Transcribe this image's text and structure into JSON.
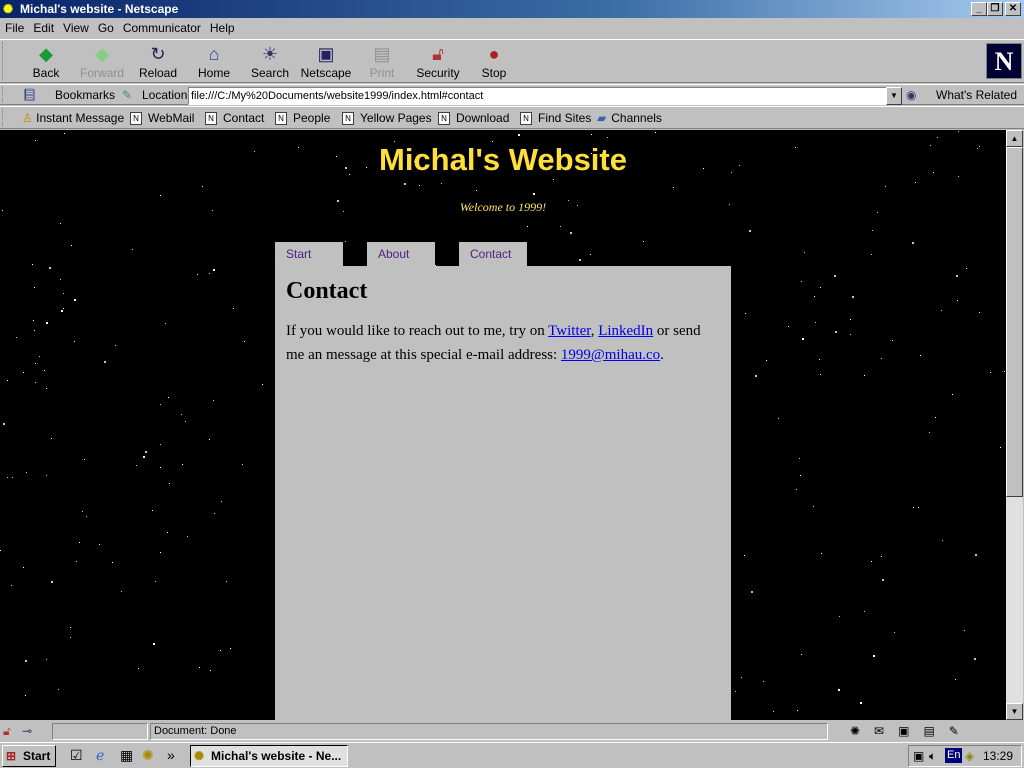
{
  "window": {
    "title": "Michal's website - Netscape",
    "controls": [
      "_",
      "❐",
      "✕"
    ]
  },
  "menu": [
    "File",
    "Edit",
    "View",
    "Go",
    "Communicator",
    "Help"
  ],
  "nav_toolbar": [
    {
      "label": "Back",
      "icon": "back-arrow-icon",
      "enabled": true
    },
    {
      "label": "Forward",
      "icon": "forward-arrow-icon",
      "enabled": false
    },
    {
      "label": "Reload",
      "icon": "reload-icon",
      "enabled": true
    },
    {
      "label": "Home",
      "icon": "home-icon",
      "enabled": true
    },
    {
      "label": "Search",
      "icon": "search-icon",
      "enabled": true
    },
    {
      "label": "Netscape",
      "icon": "my-netscape-icon",
      "enabled": true
    },
    {
      "label": "Print",
      "icon": "print-icon",
      "enabled": false
    },
    {
      "label": "Security",
      "icon": "padlock-icon",
      "enabled": true
    },
    {
      "label": "Stop",
      "icon": "stop-icon",
      "enabled": true
    }
  ],
  "location": {
    "bookmarks_label": "Bookmarks",
    "label": "Location:",
    "url": "file:///C:/My%20Documents/website1999/index.html#contact",
    "whats_related": "What's Related"
  },
  "personal_toolbar": [
    "Instant Message",
    "WebMail",
    "Contact",
    "People",
    "Yellow Pages",
    "Download",
    "Find Sites",
    "Channels"
  ],
  "page": {
    "title": "Michal's Website",
    "subtitle": "Welcome to 1999!",
    "tabs": [
      "Start",
      "About",
      "Contact"
    ],
    "heading": "Contact",
    "text1": "If you would like to reach out to me, try on ",
    "link_twitter": "Twitter",
    "comma": ", ",
    "link_linkedin": "LinkedIn",
    "text2": " or send me an message at this special e-mail address: ",
    "link_email": "1999@mihau.co",
    "period": ".",
    "colors": {
      "title": "#ffe03a",
      "background": "#000000",
      "panel": "#c0c0c0",
      "tab_text": "#502080"
    }
  },
  "status": {
    "text": "Document: Done"
  },
  "taskbar": {
    "start": "Start",
    "task": "Michal's website - Ne...",
    "lang": "En",
    "clock": "13:29"
  }
}
